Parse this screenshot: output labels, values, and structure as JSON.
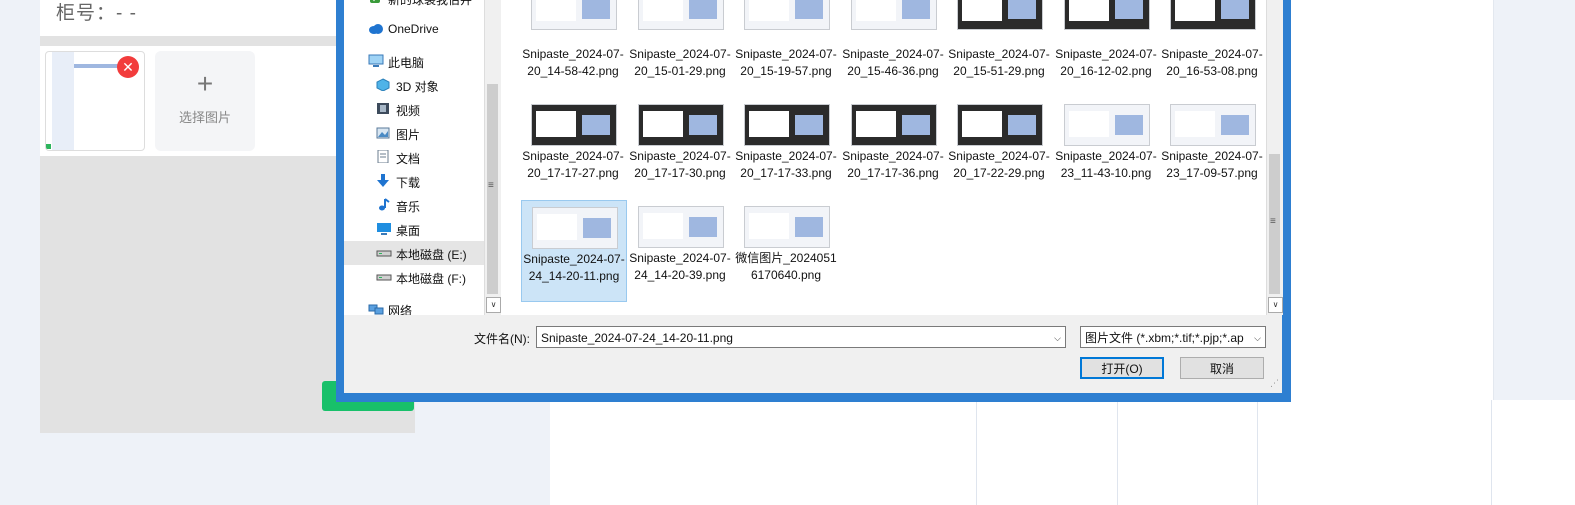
{
  "page": {
    "cabinet_label": "柜号：- -",
    "remove_icon": "✕",
    "pick_plus": "+",
    "pick_label": "选择图片"
  },
  "dialog": {
    "nav": [
      {
        "label": "新的球裳我伯井",
        "icon": "shield-check-icon",
        "selected": false
      },
      {
        "label": "OneDrive",
        "icon": "cloud-icon",
        "selected": false
      },
      {
        "label": "此电脑",
        "icon": "computer-icon",
        "selected": false
      },
      {
        "label": "3D 对象",
        "icon": "cube-icon",
        "selected": false
      },
      {
        "label": "视频",
        "icon": "film-icon",
        "selected": false
      },
      {
        "label": "图片",
        "icon": "picture-icon",
        "selected": false
      },
      {
        "label": "文档",
        "icon": "document-icon",
        "selected": false
      },
      {
        "label": "下载",
        "icon": "download-arrow-icon",
        "selected": false
      },
      {
        "label": "音乐",
        "icon": "music-note-icon",
        "selected": false
      },
      {
        "label": "桌面",
        "icon": "desktop-icon",
        "selected": false
      },
      {
        "label": "本地磁盘 (E:)",
        "icon": "drive-icon",
        "selected": true
      },
      {
        "label": "本地磁盘 (F:)",
        "icon": "drive-icon",
        "selected": false
      },
      {
        "label": "网络",
        "icon": "network-icon",
        "selected": false
      }
    ],
    "files": [
      {
        "name": "Snipaste_2024-07-20_14-58-42.png",
        "dark": false,
        "selected": false
      },
      {
        "name": "Snipaste_2024-07-20_15-01-29.png",
        "dark": false,
        "selected": false
      },
      {
        "name": "Snipaste_2024-07-20_15-19-57.png",
        "dark": false,
        "selected": false
      },
      {
        "name": "Snipaste_2024-07-20_15-46-36.png",
        "dark": false,
        "selected": false
      },
      {
        "name": "Snipaste_2024-07-20_15-51-29.png",
        "dark": true,
        "selected": false
      },
      {
        "name": "Snipaste_2024-07-20_16-12-02.png",
        "dark": true,
        "selected": false
      },
      {
        "name": "Snipaste_2024-07-20_16-53-08.png",
        "dark": true,
        "selected": false
      },
      {
        "name": "Snipaste_2024-07-20_17-17-27.png",
        "dark": true,
        "selected": false
      },
      {
        "name": "Snipaste_2024-07-20_17-17-30.png",
        "dark": true,
        "selected": false
      },
      {
        "name": "Snipaste_2024-07-20_17-17-33.png",
        "dark": true,
        "selected": false
      },
      {
        "name": "Snipaste_2024-07-20_17-17-36.png",
        "dark": true,
        "selected": false
      },
      {
        "name": "Snipaste_2024-07-20_17-22-29.png",
        "dark": true,
        "selected": false
      },
      {
        "name": "Snipaste_2024-07-23_11-43-10.png",
        "dark": false,
        "selected": false
      },
      {
        "name": "Snipaste_2024-07-23_17-09-57.png",
        "dark": false,
        "selected": false
      },
      {
        "name": "Snipaste_2024-07-24_14-20-11.png",
        "dark": false,
        "selected": true
      },
      {
        "name": "Snipaste_2024-07-24_14-20-39.png",
        "dark": false,
        "selected": false
      },
      {
        "name": "微信图片_20240516170640.png",
        "dark": false,
        "selected": false
      }
    ],
    "filename_label": "文件名(N):",
    "filename_value": "Snipaste_2024-07-24_14-20-11.png",
    "filetype_value": "图片文件 (*.xbm;*.tif;*.pjp;*.ap",
    "open_label": "打开(O)",
    "cancel_label": "取消",
    "dropdown_glyph": "⌵",
    "scroll_grip": "≡",
    "scroll_down": "∨"
  },
  "colors": {
    "dialog_border": "#2e7fd1",
    "selection": "#cce4f7",
    "green_button": "#18c06a",
    "remove_red": "#f23c3c"
  }
}
